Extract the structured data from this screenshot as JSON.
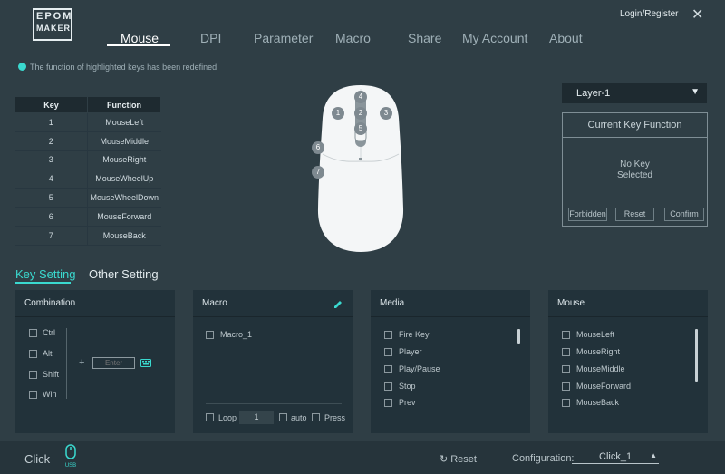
{
  "logo": {
    "line1": "EPOM",
    "line2": "MAKER"
  },
  "top": {
    "login": "Login/Register",
    "close": "✕"
  },
  "nav": [
    "Mouse",
    "DPI",
    "Parameter",
    "Macro",
    "Share",
    "My Account",
    "About"
  ],
  "notice": "The function of highlighted keys has been redefined",
  "keytable": {
    "headers": [
      "Key",
      "Function"
    ],
    "rows": [
      [
        "1",
        "MouseLeft"
      ],
      [
        "2",
        "MouseMiddle"
      ],
      [
        "3",
        "MouseRight"
      ],
      [
        "4",
        "MouseWheelUp"
      ],
      [
        "5",
        "MouseWheelDown"
      ],
      [
        "6",
        "MouseForward"
      ],
      [
        "7",
        "MouseBack"
      ]
    ]
  },
  "mouse_buttons": [
    "1",
    "2",
    "3",
    "4",
    "5",
    "6",
    "7"
  ],
  "layer": {
    "value": "Layer-1",
    "arrow": "▼"
  },
  "current_key": {
    "title": "Current Key Function",
    "msg1": "No Key",
    "msg2": "Selected",
    "forbidden": "Forbidden",
    "reset": "Reset",
    "confirm": "Confirm"
  },
  "tabs": {
    "key": "Key Setting",
    "other": "Other Setting"
  },
  "combination": {
    "title": "Combination",
    "items": [
      "Ctrl",
      "Alt",
      "Shift",
      "Win"
    ],
    "plus": "+",
    "enter_placeholder": "Enter"
  },
  "macro": {
    "title": "Macro",
    "items": [
      "Macro_1"
    ],
    "loop": "Loop",
    "loop_count": "1",
    "auto": "auto",
    "press": "Press"
  },
  "media": {
    "title": "Media",
    "items": [
      "Fire Key",
      "Player",
      "Play/Pause",
      "Stop",
      "Prev"
    ]
  },
  "mouse_panel": {
    "title": "Mouse",
    "items": [
      "MouseLeft",
      "MouseRight",
      "MouseMiddle",
      "MouseForward",
      "MouseBack"
    ]
  },
  "bottom": {
    "click": "Click",
    "usb": "USB",
    "reset": "Reset",
    "config_label": "Configuration:",
    "config_value": "Click_1",
    "config_arrow": "▲"
  },
  "colors": {
    "accent": "#3ad9cf",
    "bg": "#2f3e45",
    "panel": "#22323a"
  }
}
